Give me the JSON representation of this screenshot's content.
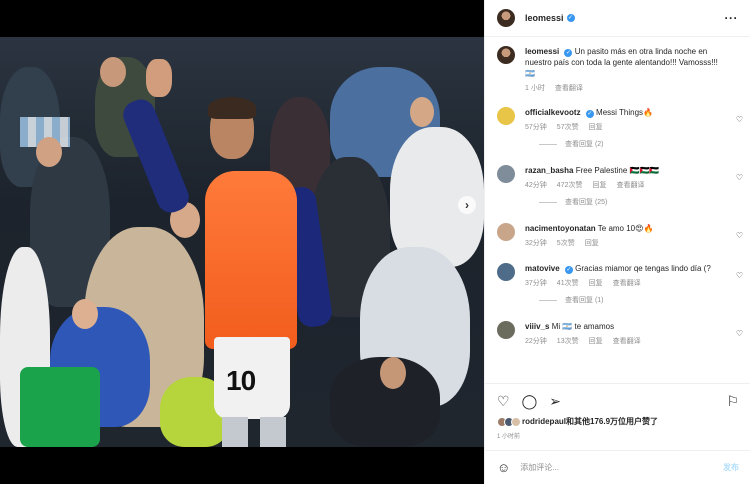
{
  "post_header": {
    "username": "leomessi",
    "more_icon": "more-horizontal-icon"
  },
  "photo": {
    "shorts_number": "10",
    "next_icon": "›"
  },
  "caption": {
    "username": "leomessi",
    "text": "Un pasito más en otra linda noche en nuestro país con toda la gente alentando!!! Vamosss!!! 🇦🇷",
    "time": "1 小时",
    "translate": "查看翻译"
  },
  "comments": [
    {
      "username": "officialkevootz",
      "verified": true,
      "text": "Messi Things🔥",
      "time": "57分钟",
      "likes": "57次赞",
      "reply": "回复",
      "view_replies": "查看回复 (2)",
      "avatar_color": "#e8c547"
    },
    {
      "username": "razan_basha",
      "verified": false,
      "text": "Free Palestine 🇵🇸🇵🇸🇵🇸",
      "time": "42分钟",
      "likes": "472次赞",
      "reply": "回复",
      "translate": "查看翻译",
      "view_replies": "查看回复 (25)",
      "avatar_color": "#7f8c99"
    },
    {
      "username": "nacimentoyonatan",
      "verified": false,
      "text": "Te amo 10😍🔥",
      "time": "32分钟",
      "likes": "5次赞",
      "reply": "回复",
      "avatar_color": "#c9a58a"
    },
    {
      "username": "matovive",
      "verified": true,
      "text": "Gracias miamor qe tengas lindo día (?",
      "time": "37分钟",
      "likes": "41次赞",
      "reply": "回复",
      "translate": "查看翻译",
      "view_replies": "查看回复 (1)",
      "avatar_color": "#4e6b8a"
    },
    {
      "username": "viiiv_s",
      "verified": false,
      "text": "Mi 🇦🇷 te amamos",
      "time": "22分钟",
      "likes": "13次赞",
      "reply": "回复",
      "translate": "查看翻译",
      "avatar_color": "#6b6b5e"
    }
  ],
  "actions": {
    "likes_text": "rodridepaul和其他176.9万位用户赞了",
    "time": "1 小时前"
  },
  "add_comment": {
    "placeholder": "添加评论...",
    "post": "发布"
  },
  "colors": {
    "verified": "#3897f0",
    "secondary_text": "#8e8e8e",
    "vest": "#f25d1d"
  }
}
